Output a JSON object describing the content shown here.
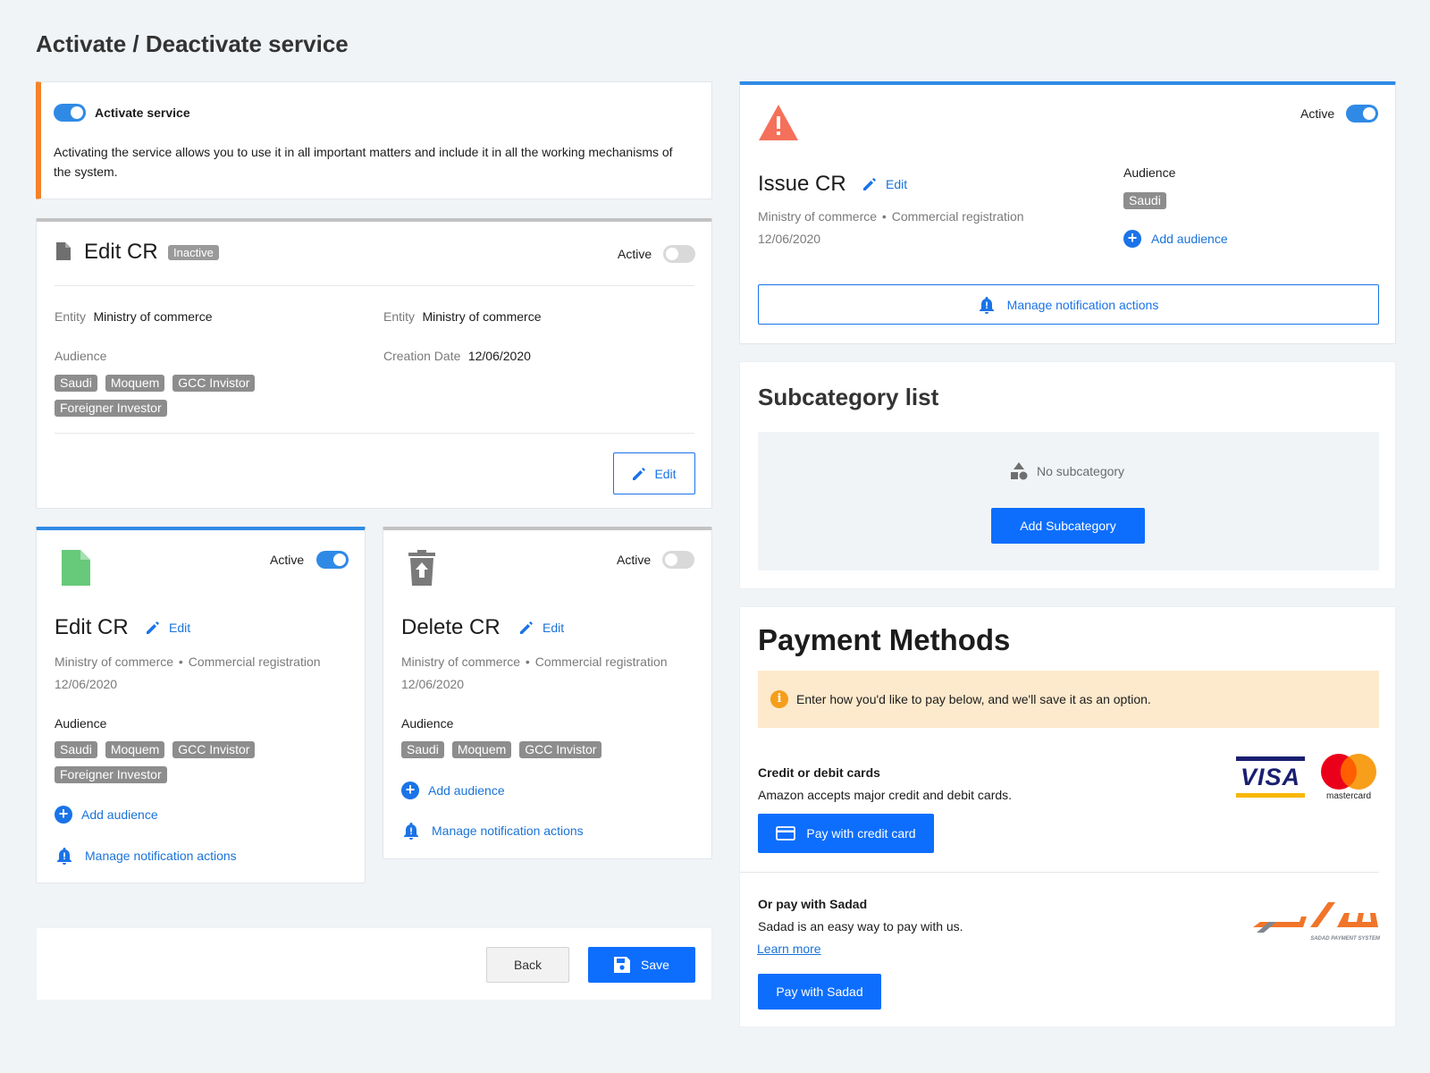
{
  "page_title": "Activate / Deactivate service",
  "activate_card": {
    "toggle_label": "Activate service",
    "description": "Activating the service allows you to use it in all important matters and include it in all the working mechanisms of the system."
  },
  "edit_cr_detail": {
    "title": "Edit CR",
    "status_badge": "Inactive",
    "active_label": "Active",
    "entity_label_1": "Entity",
    "entity_value_1": "Ministry of commerce",
    "entity_label_2": "Entity",
    "entity_value_2": "Ministry of commerce",
    "audience_label": "Audience",
    "creation_label": "Creation Date",
    "creation_value": "12/06/2020",
    "audience": [
      "Saudi",
      "Moquem",
      "GCC Invistor",
      "Foreigner Investor"
    ],
    "edit_button": "Edit"
  },
  "card_edit_cr": {
    "active_label": "Active",
    "title": "Edit CR",
    "edit_link": "Edit",
    "ministry": "Ministry of commerce",
    "category": "Commercial registration",
    "date": "12/06/2020",
    "audience_label": "Audience",
    "audience": [
      "Saudi",
      "Moquem",
      "GCC Invistor",
      "Foreigner Investor"
    ],
    "add_audience": "Add audience",
    "manage_notifications": "Manage notification actions"
  },
  "card_delete_cr": {
    "active_label": "Active",
    "title": "Delete CR",
    "edit_link": "Edit",
    "ministry": "Ministry of commerce",
    "category": "Commercial registration",
    "date": "12/06/2020",
    "audience_label": "Audience",
    "audience": [
      "Saudi",
      "Moquem",
      "GCC Invistor"
    ],
    "add_audience": "Add audience",
    "manage_notifications": "Manage notification actions"
  },
  "footer": {
    "back": "Back",
    "save": "Save"
  },
  "issue_cr": {
    "active_label": "Active",
    "title": "Issue CR",
    "edit_link": "Edit",
    "ministry": "Ministry of commerce",
    "category": "Commercial registration",
    "date": "12/06/2020",
    "audience_label": "Audience",
    "audience": [
      "Saudi"
    ],
    "add_audience": "Add audience",
    "manage_notifications": "Manage notification actions"
  },
  "subcategory": {
    "title": "Subcategory list",
    "empty_text": "No subcategory",
    "add_button": "Add Subcategory"
  },
  "payment": {
    "title": "Payment Methods",
    "info": "Enter how you'd like to pay below, and we'll save it as an option.",
    "cards_title": "Credit or debit cards",
    "cards_desc": "Amazon accepts major credit and debit cards.",
    "pay_card_button": "Pay with credit card",
    "visa_text": "VISA",
    "mastercard_text": "mastercard",
    "sadad_title": "Or pay with Sadad",
    "sadad_desc": "Sadad is an easy way to pay with us.",
    "learn_more": "Learn more",
    "sadad_logo_caption": "SADAD PAYMENT SYSTEM",
    "pay_sadad_button": "Pay with Sadad"
  },
  "colors": {
    "accent": "#0d6efd",
    "toggle_on": "#2f8ae6",
    "warning_orange": "#f5822a",
    "info_bg": "#fde9cc"
  }
}
